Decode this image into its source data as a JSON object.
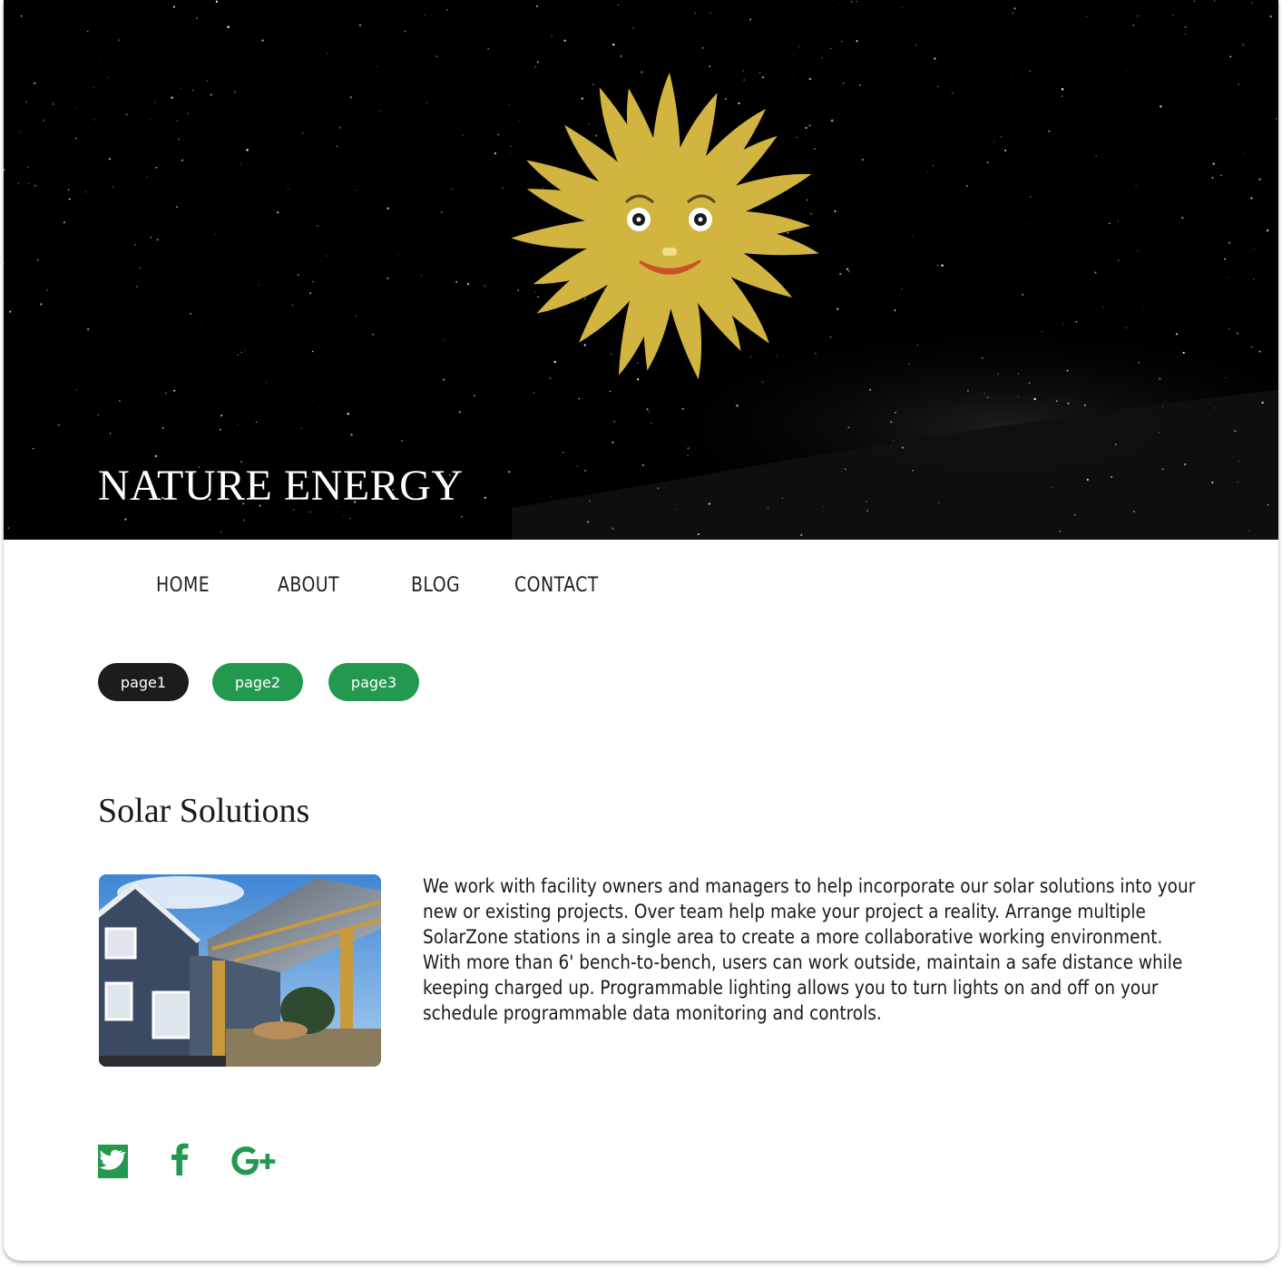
{
  "site": {
    "title": "NATURE ENERGY"
  },
  "nav": {
    "items": [
      {
        "label": "HOME"
      },
      {
        "label": "ABOUT"
      },
      {
        "label": "BLOG"
      },
      {
        "label": "CONTACT"
      }
    ]
  },
  "pager": {
    "items": [
      {
        "label": "page1",
        "active": true
      },
      {
        "label": "page2",
        "active": false
      },
      {
        "label": "page3",
        "active": false
      }
    ]
  },
  "section": {
    "title": "Solar Solutions",
    "body": "We work with facility owners and managers to help incorporate our solar solutions into your new or existing projects. Over team help make your project a reality. Arrange multiple SolarZone stations in a single area to create a more collaborative working environment. With more than 6' bench-to-bench, users can work outside, maintain a safe distance while keeping charged up. Programmable lighting allows you to turn lights on and off on your schedule programmable data monitoring and controls."
  },
  "social": {
    "icons": [
      "twitter-icon",
      "facebook-icon",
      "google-plus-icon"
    ]
  },
  "colors": {
    "accent_green": "#23984f",
    "active_pill": "#1c1c1c",
    "sun_yellow": "#d2b441",
    "hero_bg": "#000000"
  }
}
